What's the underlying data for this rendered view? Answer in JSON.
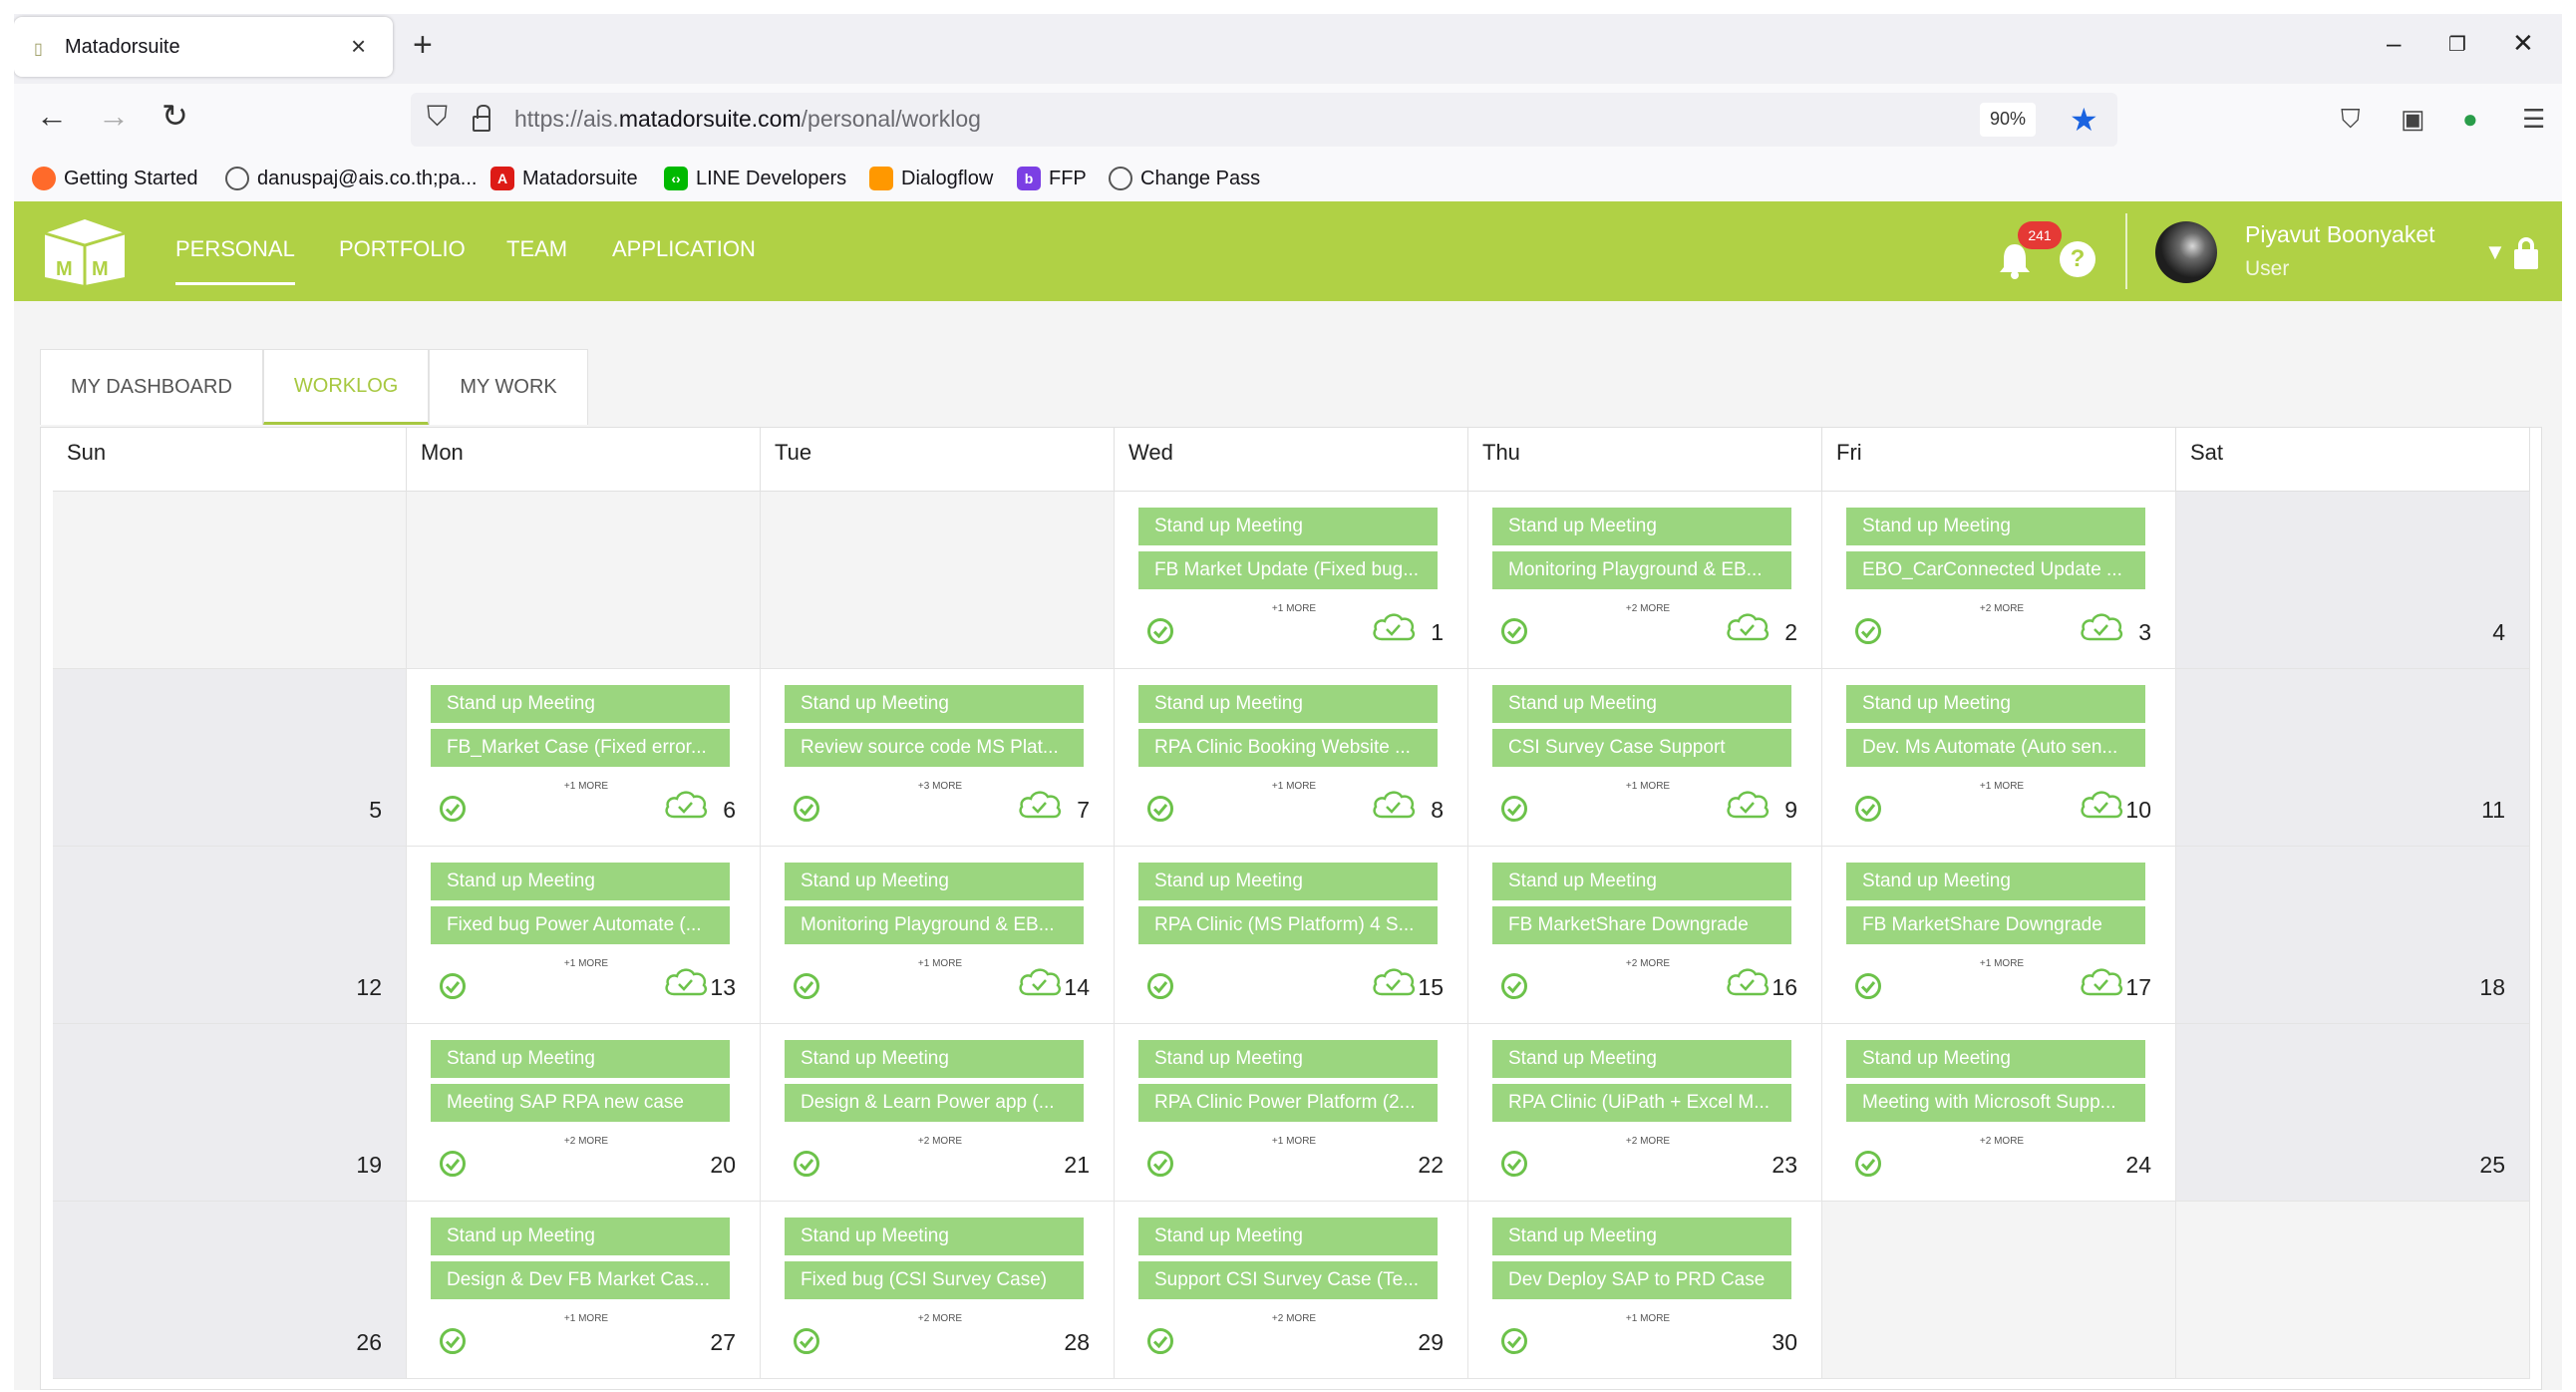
{
  "browser": {
    "tab_title": "Matadorsuite",
    "url_prefix": "https://ais.",
    "url_domain": "matadorsuite.com",
    "url_path": "/personal/worklog",
    "zoom": "90%",
    "bookmarks": [
      {
        "label": "Getting Started",
        "color": "#ff6a2a"
      },
      {
        "label": "danuspaj@ais.co.th;pa...",
        "color": "#555555"
      },
      {
        "label": "Matadorsuite",
        "color": "#dd1b16"
      },
      {
        "label": "LINE Developers",
        "color": "#00b900"
      },
      {
        "label": "Dialogflow",
        "color": "#ff9800"
      },
      {
        "label": "FFP",
        "color": "#7b3fe4"
      },
      {
        "label": "Change Pass",
        "color": "#555555"
      }
    ]
  },
  "app": {
    "accent": "#b0d145",
    "nav": [
      "PERSONAL",
      "PORTFOLIO",
      "TEAM",
      "APPLICATION"
    ],
    "notification_count": "241",
    "user_name": "Piyavut Boonyaket",
    "user_role": "User",
    "subtabs": [
      "MY DASHBOARD",
      "WORKLOG",
      "MY WORK"
    ],
    "active_subtab": "WORKLOG"
  },
  "calendar": {
    "weekdays": [
      "Sun",
      "Mon",
      "Tue",
      "Wed",
      "Thu",
      "Fri",
      "Sat"
    ],
    "event_color": "#9bd67f",
    "weeks": [
      [
        {
          "day": "",
          "events": [],
          "more": ""
        },
        {
          "day": "",
          "events": [],
          "more": ""
        },
        {
          "day": "",
          "events": [],
          "more": ""
        },
        {
          "day": "1",
          "events": [
            "Stand up Meeting",
            "FB Market Update (Fixed bug..."
          ],
          "more": "+1 MORE"
        },
        {
          "day": "2",
          "events": [
            "Stand up Meeting",
            "Monitoring Playground & EB..."
          ],
          "more": "+2 MORE"
        },
        {
          "day": "3",
          "events": [
            "Stand up Meeting",
            "EBO_CarConnected Update ..."
          ],
          "more": "+2 MORE"
        },
        {
          "day": "4",
          "events": [],
          "more": ""
        }
      ],
      [
        {
          "day": "5",
          "events": [],
          "more": ""
        },
        {
          "day": "6",
          "events": [
            "Stand up Meeting",
            "FB_Market Case (Fixed error..."
          ],
          "more": "+1 MORE"
        },
        {
          "day": "7",
          "events": [
            "Stand up Meeting",
            "Review source code MS Plat..."
          ],
          "more": "+3 MORE"
        },
        {
          "day": "8",
          "events": [
            "Stand up Meeting",
            "RPA Clinic Booking Website ..."
          ],
          "more": "+1 MORE"
        },
        {
          "day": "9",
          "events": [
            "Stand up Meeting",
            "CSI Survey Case Support"
          ],
          "more": "+1 MORE"
        },
        {
          "day": "10",
          "events": [
            "Stand up Meeting",
            "Dev. Ms Automate (Auto sen..."
          ],
          "more": "+1 MORE"
        },
        {
          "day": "11",
          "events": [],
          "more": ""
        }
      ],
      [
        {
          "day": "12",
          "events": [],
          "more": ""
        },
        {
          "day": "13",
          "events": [
            "Stand up Meeting",
            "Fixed bug Power Automate (..."
          ],
          "more": "+1 MORE"
        },
        {
          "day": "14",
          "events": [
            "Stand up Meeting",
            "Monitoring Playground & EB..."
          ],
          "more": "+1 MORE"
        },
        {
          "day": "15",
          "events": [
            "Stand up Meeting",
            "RPA Clinic (MS Platform) 4 S..."
          ],
          "more": ""
        },
        {
          "day": "16",
          "events": [
            "Stand up Meeting",
            "FB MarketShare Downgrade"
          ],
          "more": "+2 MORE"
        },
        {
          "day": "17",
          "events": [
            "Stand up Meeting",
            "FB MarketShare Downgrade"
          ],
          "more": "+1 MORE"
        },
        {
          "day": "18",
          "events": [],
          "more": ""
        }
      ],
      [
        {
          "day": "19",
          "events": [],
          "more": ""
        },
        {
          "day": "20",
          "events": [
            "Stand up Meeting",
            "Meeting SAP RPA new case"
          ],
          "more": "+2 MORE"
        },
        {
          "day": "21",
          "events": [
            "Stand up Meeting",
            "Design & Learn Power app (..."
          ],
          "more": "+2 MORE"
        },
        {
          "day": "22",
          "events": [
            "Stand up Meeting",
            "RPA Clinic Power Platform (2..."
          ],
          "more": "+1 MORE"
        },
        {
          "day": "23",
          "events": [
            "Stand up Meeting",
            "RPA Clinic (UiPath + Excel M..."
          ],
          "more": "+2 MORE"
        },
        {
          "day": "24",
          "events": [
            "Stand up Meeting",
            "Meeting with Microsoft Supp..."
          ],
          "more": "+2 MORE"
        },
        {
          "day": "25",
          "events": [],
          "more": ""
        }
      ],
      [
        {
          "day": "26",
          "events": [],
          "more": ""
        },
        {
          "day": "27",
          "events": [
            "Stand up Meeting",
            "Design & Dev FB Market Cas..."
          ],
          "more": "+1 MORE"
        },
        {
          "day": "28",
          "events": [
            "Stand up Meeting",
            "Fixed bug (CSI Survey Case)"
          ],
          "more": "+2 MORE"
        },
        {
          "day": "29",
          "events": [
            "Stand up Meeting",
            "Support CSI Survey Case (Te..."
          ],
          "more": "+2 MORE"
        },
        {
          "day": "30",
          "events": [
            "Stand up Meeting",
            "Dev Deploy SAP to PRD Case"
          ],
          "more": "+1 MORE"
        },
        {
          "day": "",
          "events": [],
          "more": ""
        },
        {
          "day": "",
          "events": [],
          "more": ""
        }
      ]
    ],
    "cloud_days": [
      "1",
      "2",
      "3",
      "6",
      "7",
      "8",
      "9",
      "10",
      "13",
      "14",
      "15",
      "16",
      "17"
    ]
  }
}
